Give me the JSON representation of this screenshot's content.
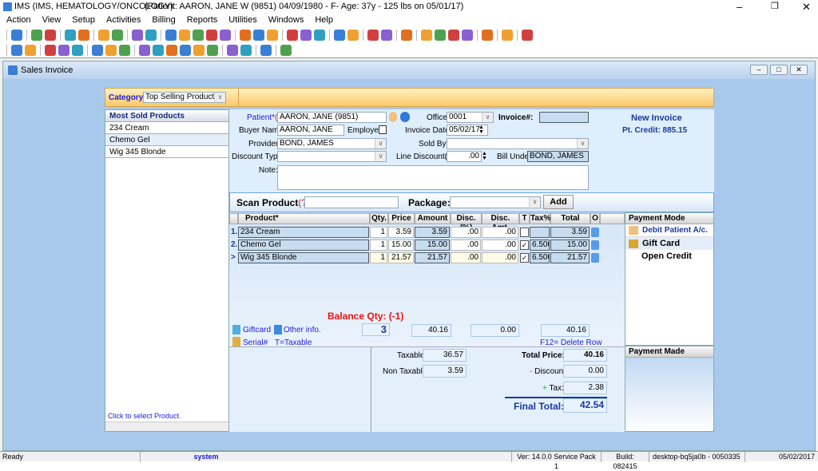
{
  "app": {
    "title": "IMS (IMS, HEMATOLOGY/ONCOLOGY)",
    "patient_banner": "(Patient: AARON, JANE W (9851) 04/09/1980 - F- Age: 37y  - 125 lbs on 05/01/17)"
  },
  "menu": [
    "Action",
    "View",
    "Setup",
    "Activities",
    "Billing",
    "Reports",
    "Utilities",
    "Windows",
    "Help"
  ],
  "toolbar1": [
    "user-icon",
    "|",
    "doctor-icon",
    "doctor-edit-icon",
    "|",
    "folder-icon",
    "edit-icon",
    "|",
    "report-icon",
    "flask-icon",
    "|",
    "document-icon",
    "notes-icon",
    "|",
    "dollar-icon",
    "billing-icon",
    "payment-icon",
    "claims-icon",
    "refund-icon",
    "|",
    "calendar-icon",
    "scheduler-icon",
    "task-icon",
    "|",
    "mail-icon",
    "globe-icon",
    "transfer-icon",
    "|",
    "chart-icon",
    "checklist-icon",
    "|",
    "bar-chart-icon",
    "inbox-icon",
    "|",
    "clipboard-icon",
    "|",
    "import-icon",
    "export-icon",
    "batch-icon",
    "print-icon",
    "|",
    "help-icon",
    "|",
    "lock-icon",
    "|",
    "exit-icon"
  ],
  "toolbar2": [
    "open-icon",
    "binoculars-icon",
    "|",
    "gear-icon",
    "edit-disabled-icon",
    "delete-disabled-icon",
    "|",
    "save-icon",
    "folder-open-icon",
    "globe-sync-icon",
    "|",
    "first-record-icon",
    "prev-record-icon",
    "next-record-icon",
    "last-record-icon",
    "sort-icon",
    "preview-icon",
    "|",
    "refresh-icon",
    "print-setup-icon",
    "|",
    "help-icon",
    "|",
    "close-icon"
  ],
  "window": {
    "title": "Sales Invoice"
  },
  "category": {
    "label": "Category:",
    "value": "Top Selling Products"
  },
  "left_panel": {
    "header": "Most Sold Products",
    "items": [
      "234 Cream",
      "Chemo Gel",
      "Wig 345 Blonde"
    ],
    "hint": "Click to select Product."
  },
  "form": {
    "patient_label": "Patient*",
    "help": "(?)",
    "patient": "AARON, JANE  (9851)",
    "office_label": "Office:",
    "office": "0001",
    "invoice_label": "Invoice#:",
    "invoice": "",
    "new_invoice": "New Invoice",
    "pt_credit": "Pt. Credit:  885.15",
    "buyer_label": "Buyer Name:",
    "buyer": "AARON, JANE",
    "employee_label": "Employee:",
    "invoice_date_label": "Invoice Date*",
    "invoice_date": "05/02/17",
    "provider_label": "Provider*",
    "provider": "BOND, JAMES",
    "sold_by_label": "Sold By*",
    "sold_by": "",
    "discount_type_label": "Discount Type:",
    "discount_type": "",
    "line_discount_label": "Line Discount($):",
    "line_discount": ".00",
    "bill_under_label": "Bill Under:",
    "bill_under": "BOND, JAMES",
    "note_label": "Note:",
    "note": ""
  },
  "scan": {
    "label": "Scan Product",
    "help": "(?)",
    "value": "",
    "package_label": "Package:",
    "package": "",
    "add": "Add"
  },
  "grid": {
    "headers": [
      "Product*",
      "Qty.",
      "Price",
      "Amount",
      "Disc.(%)",
      "Disc. Amt.",
      "T",
      "Tax%",
      "Total",
      "O"
    ],
    "rows": [
      {
        "num": "1.",
        "product": "234 Cream",
        "qty": "1",
        "price": "3.59",
        "amount": "3.59",
        "disc_pct": ".00",
        "disc_amt": ".00",
        "taxable": false,
        "tax_pct": "",
        "total": "3.59"
      },
      {
        "num": "2.",
        "product": "Chemo Gel",
        "qty": "1",
        "price": "15.00",
        "amount": "15.00",
        "disc_pct": ".00",
        "disc_amt": ".00",
        "taxable": true,
        "tax_pct": "6.500",
        "total": "15.00"
      },
      {
        "num": ">",
        "product": "Wig 345 Blonde",
        "qty": "1",
        "price": "21.57",
        "amount": "21.57",
        "disc_pct": ".00",
        "disc_amt": ".00",
        "taxable": true,
        "tax_pct": "6.500",
        "total": "21.57"
      }
    ]
  },
  "summary": {
    "balance_qty": "Balance Qty: (-1)",
    "giftcard": "Giftcard",
    "other_info": "Other info.",
    "serial": "Serial#",
    "taxable_note": "T=Taxable",
    "delete_row": "F12= Delete Row",
    "total_qty": "3",
    "total_amount": "40.16",
    "total_disc": "0.00",
    "total_total": "40.16"
  },
  "totals": {
    "taxable_label": "Taxable:",
    "taxable": "36.57",
    "non_taxable_label": "Non Taxable:",
    "non_taxable": "3.59",
    "total_price_label": "Total Price:",
    "total_price": "40.16",
    "discount_label": "Discount:",
    "discount": "0.00",
    "tax_label": "Tax:",
    "tax": "2.38",
    "final_label": "Final Total:",
    "final": "42.54"
  },
  "payment": {
    "mode_header": "Payment Mode",
    "modes": [
      "Debit Patient A/c.",
      "Gift Card",
      "Open Credit"
    ],
    "made_header": "Payment Made"
  },
  "status": {
    "ready": "Ready",
    "user": "system",
    "version": "Ver: 14.0.0 Service Pack 1",
    "build": "Build: 082415",
    "machine": "desktop-bq5ja0b - 0050335",
    "date": "05/02/2017"
  },
  "colors": {
    "accent": "#1a1adf",
    "window_bg": "#a9c9ec",
    "category_bar": "#fbc76a",
    "balance": "#ee1111"
  }
}
